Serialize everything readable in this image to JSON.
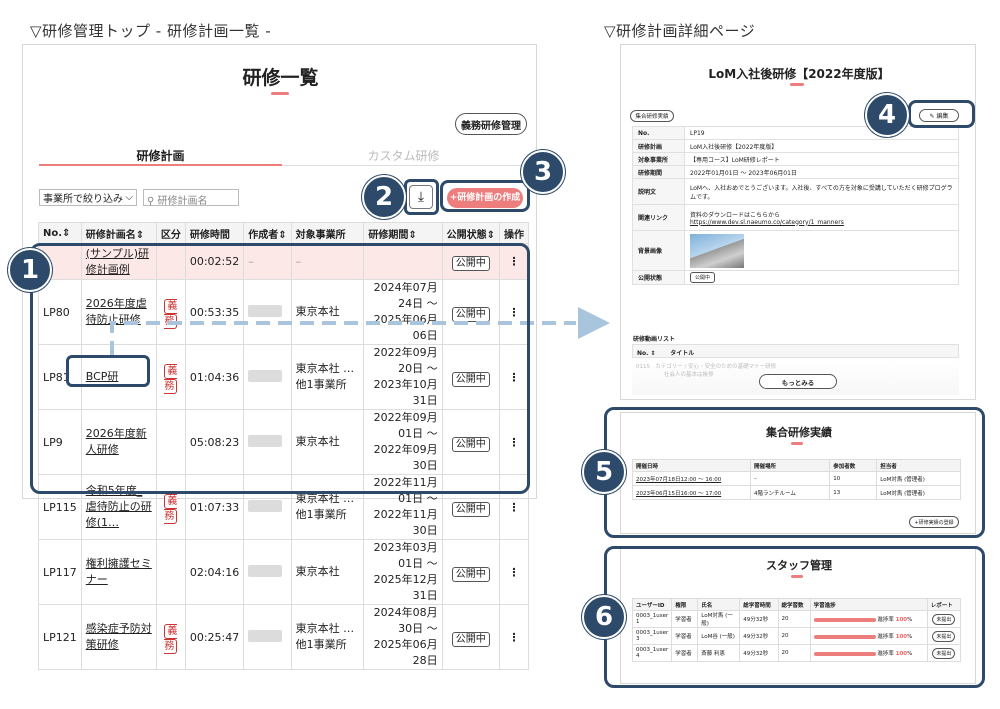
{
  "captions": {
    "left": "▽研修管理トップ - 研修計画一覧 -",
    "right": "▽研修計画詳細ページ"
  },
  "list_page": {
    "title": "研修一覧",
    "mandatory_button": "義務研修管理",
    "tabs": [
      "研修計画",
      "カスタム研修"
    ],
    "filter_select": "事業所で絞り込み",
    "search_placeholder": "研修計画名",
    "create_button": "+研修計画の作成",
    "columns": [
      "No.",
      "研修計画名",
      "区分",
      "研修時間",
      "作成者",
      "対象事業所",
      "研修期間",
      "公開状態",
      "操作"
    ],
    "rows": [
      {
        "no": "",
        "name": "(サンプル)研修計画例",
        "kubun": "",
        "time": "00:02:52",
        "author": "–",
        "office": "–",
        "period": "",
        "status": "公開中"
      },
      {
        "no": "LP80",
        "name": "2026年度虐待防止研修",
        "kubun": "義務",
        "time": "00:53:35",
        "author": "",
        "office": "東京本社",
        "period": "2024年07月24日 〜 2025年06月06日",
        "status": "公開中"
      },
      {
        "no": "LP81",
        "name": "BCP研",
        "kubun": "義務",
        "time": "01:04:36",
        "author": "",
        "office": "東京本社 …他1事業所",
        "period": "2022年09月20日 〜 2023年10月31日",
        "status": "公開中"
      },
      {
        "no": "LP9",
        "name": "2026年度新人研修",
        "kubun": "",
        "time": "05:08:23",
        "author": "",
        "office": "東京本社",
        "period": "2022年09月01日 〜 2022年09月30日",
        "status": "公開中"
      },
      {
        "no": "LP115",
        "name": "令和5年度_虐待防止の研修(1…",
        "kubun": "義務",
        "time": "01:07:33",
        "author": "",
        "office": "東京本社 …他1事業所",
        "period": "2022年11月01日 〜 2022年11月30日",
        "status": "公開中"
      },
      {
        "no": "LP117",
        "name": "権利擁護セミナー",
        "kubun": "",
        "time": "02:04:16",
        "author": "",
        "office": "東京本社",
        "period": "2023年03月01日 〜 2025年12月31日",
        "status": "公開中"
      },
      {
        "no": "LP121",
        "name": "感染症予防対策研修",
        "kubun": "義務",
        "time": "00:25:47",
        "author": "",
        "office": "東京本社 …他1事業所",
        "period": "2024年08月30日 〜 2025年06月28日",
        "status": "公開中"
      }
    ]
  },
  "detail_page": {
    "title": "LoM入社後研修【2022年度版】",
    "record_button": "集合研修実績",
    "edit_button": "✎ 編集",
    "fields": [
      {
        "k": "No.",
        "v": "LP19"
      },
      {
        "k": "研修計画",
        "v": "LoM入社後研修【2022年度版】"
      },
      {
        "k": "対象事業所",
        "v": "【専用コース】LoM研修レポート"
      },
      {
        "k": "研修期間",
        "v": "2022年01月01日 〜 2023年06月01日"
      },
      {
        "k": "説明文",
        "v": "LoMへ、入社おめでとうございます。入社後、すべての方を対象に受講していただく研修プログラムです。"
      },
      {
        "k": "関連リンク",
        "v": "資料のダウンロードはこちらから",
        "v2": "https://www.dev.sl.naeumo.co/category/1_manners"
      },
      {
        "k": "背景画像",
        "v": ""
      },
      {
        "k": "公開状態",
        "v": "公開中"
      }
    ],
    "video_list_header": "研修動画リスト",
    "video_cols": [
      "No.",
      "タイトル"
    ],
    "video_row": {
      "no": "0115",
      "title": "カテゴリー / 安心・安全のための基礎マナー研修"
    },
    "video_row2": "社会人の基本は挨拶",
    "more_button": "もっとみる"
  },
  "group_panel": {
    "title": "集合研修実績",
    "columns": [
      "開催日時",
      "開催場所",
      "参加者数",
      "担当者"
    ],
    "rows": [
      {
        "date": "2023年07月18日12:00 〜 16:00",
        "place": "–",
        "count": "10",
        "person": "LoM対馬 (管理者)"
      },
      {
        "date": "2023年06月15日16:00 〜 17:00",
        "place": "4階ランチルーム",
        "count": "13",
        "person": "LoM対馬 (管理者)"
      }
    ],
    "register_button": "+研修実績の登録"
  },
  "staff_panel": {
    "title": "スタッフ管理",
    "columns": [
      "ユーザーID",
      "権限",
      "氏名",
      "総学習時間",
      "総学習数",
      "学習進捗",
      "レポート"
    ],
    "rows": [
      {
        "id": "0003_1user 1",
        "role": "学習者",
        "name": "LoM対馬 (一般)",
        "time": "49分32秒",
        "count": "20",
        "progress_label": "進捗率",
        "progress": "100",
        "report": "未提出"
      },
      {
        "id": "0003_1user 3",
        "role": "学習者",
        "name": "LoM谷 (一般)",
        "time": "49分32秒",
        "count": "20",
        "progress_label": "進捗率",
        "progress": "100",
        "report": "未提出"
      },
      {
        "id": "0003_1user 4",
        "role": "学習者",
        "name": "斎藤 利恵",
        "time": "49分32秒",
        "count": "20",
        "progress_label": "進捗率",
        "progress": "100",
        "report": "未提出"
      }
    ],
    "percent_sign": "%"
  },
  "callouts": [
    "1",
    "2",
    "3",
    "4",
    "5",
    "6"
  ],
  "colors": {
    "accent": "#ee7d7d",
    "highlight": "#2d4a6b",
    "arrow": "#a9c4dd"
  }
}
